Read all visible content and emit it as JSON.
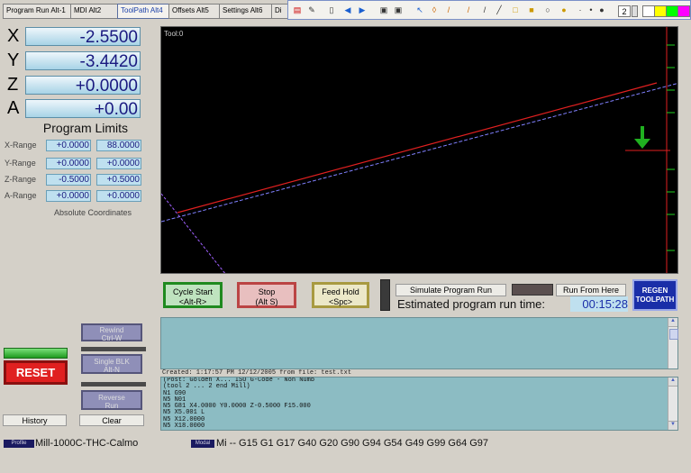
{
  "tabs": [
    {
      "label": "Program Run Alt-1"
    },
    {
      "label": "MDI Alt2"
    },
    {
      "label": "ToolPath Alt4"
    },
    {
      "label": "Offsets Alt5"
    },
    {
      "label": "Settings Alt6"
    },
    {
      "label": "Di"
    }
  ],
  "toolbar": {
    "zoom_value": "2",
    "colors": [
      "#ffffff",
      "#ffff00",
      "#00ff00",
      "#ff00ff",
      "#ff0000"
    ]
  },
  "dro": {
    "x": {
      "label": "X",
      "value": "-2.5500"
    },
    "y": {
      "label": "Y",
      "value": "-3.4420"
    },
    "z": {
      "label": "Z",
      "value": "+0.0000"
    },
    "a": {
      "label": "A",
      "value": "+0.00"
    }
  },
  "program_limits": {
    "title": "Program Limits",
    "rows": [
      {
        "label": "X-Range",
        "min": "+0.0000",
        "max": "88.0000"
      },
      {
        "label": "Y-Range",
        "min": "+0.0000",
        "max": "+0.0000"
      },
      {
        "label": "Z-Range",
        "min": "-0.5000",
        "max": "+0.5000"
      },
      {
        "label": "A-Range",
        "min": "+0.0000",
        "max": "+0.0000"
      }
    ],
    "footer": "Absolute Coordinates"
  },
  "toolpath": {
    "label": "Tool:0"
  },
  "buttons": {
    "cycle_start": {
      "line1": "Cycle Start",
      "line2": "<Alt-R>"
    },
    "stop": {
      "line1": "Stop",
      "line2": "(Alt S)"
    },
    "feed_hold": {
      "line1": "Feed Hold",
      "line2": "<Spc>"
    },
    "simulate": "Simulate Program Run",
    "run_from_here": "Run From Here",
    "regen": {
      "line1": "REGEN",
      "line2": "TOOLPATH"
    },
    "rewind": {
      "line1": "Rewind",
      "line2": "Ctrl-W"
    },
    "single_blk": {
      "line1": "Single BLK",
      "line2": "Alt-N"
    },
    "reverse_run": {
      "line1": "Reverse",
      "line2": "Run"
    },
    "reset": "RESET",
    "history": "History",
    "clear": "Clear"
  },
  "estimated": {
    "label": "Estimated program run time:",
    "value": "00:15:28"
  },
  "gcode": {
    "header": "Created: 1:17:57 PM 12/12/2005 from file: test.txt",
    "lines": [
      "(Post: Golden X... ISO G-Code - Non Numb",
      "(tool 2 ... 2 end Mill)",
      "N1 G90",
      "N5 N01",
      "N5 G81 X4.0000 Y0.0000 Z-0.5000 F15.000",
      "N5 X5.001 L",
      "N5 X12.0000",
      "N5 X18.0000"
    ]
  },
  "status": {
    "profile_badge": "Profile",
    "profile_value": "Mill-1000C-THC-Calmo",
    "modal_badge": "Modal",
    "modal_value": "Mi -- G15 G1 G17 G40 G20 G90 G94 G54 G49 G99 G64 G97"
  }
}
